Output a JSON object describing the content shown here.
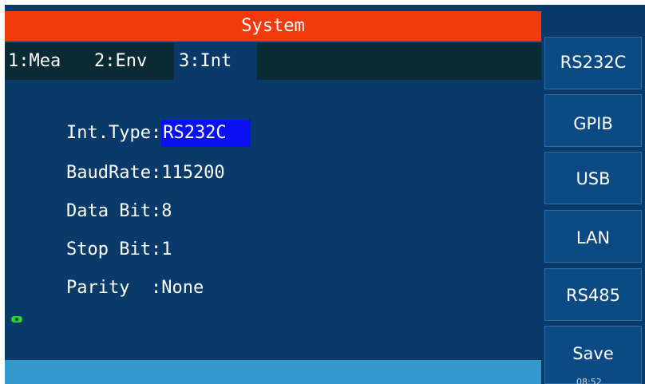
{
  "header": {
    "title": "System"
  },
  "tabs": [
    {
      "label": "1:Mea"
    },
    {
      "label": "2:Env"
    },
    {
      "label": "3:Int"
    }
  ],
  "fields": {
    "int_type": {
      "label": "Int.Type",
      "sep": ":",
      "value": "RS232C"
    },
    "baud_rate": {
      "label": "BaudRate",
      "sep": ":",
      "value": "115200"
    },
    "data_bit": {
      "label": "Data Bit",
      "sep": ":",
      "value": "8"
    },
    "stop_bit": {
      "label": "Stop Bit",
      "sep": ":",
      "value": "1"
    },
    "parity": {
      "label": "Parity  ",
      "sep": ":",
      "value": "None"
    }
  },
  "softkeys": {
    "rs232c": "RS232C",
    "gpib": "GPIB",
    "usb": "USB",
    "lan": "LAN",
    "rs485": "RS485",
    "save": "Save"
  },
  "status": {
    "time": "08:52"
  },
  "colors": {
    "screen_bg": "#0a3a6a",
    "title_bg": "#f23a0c",
    "tab_row_bg": "#0a2a34",
    "selected_value_bg": "#0a10f2",
    "bottom_bar_bg": "#3399cc",
    "status_icon": "#2bd62b"
  }
}
